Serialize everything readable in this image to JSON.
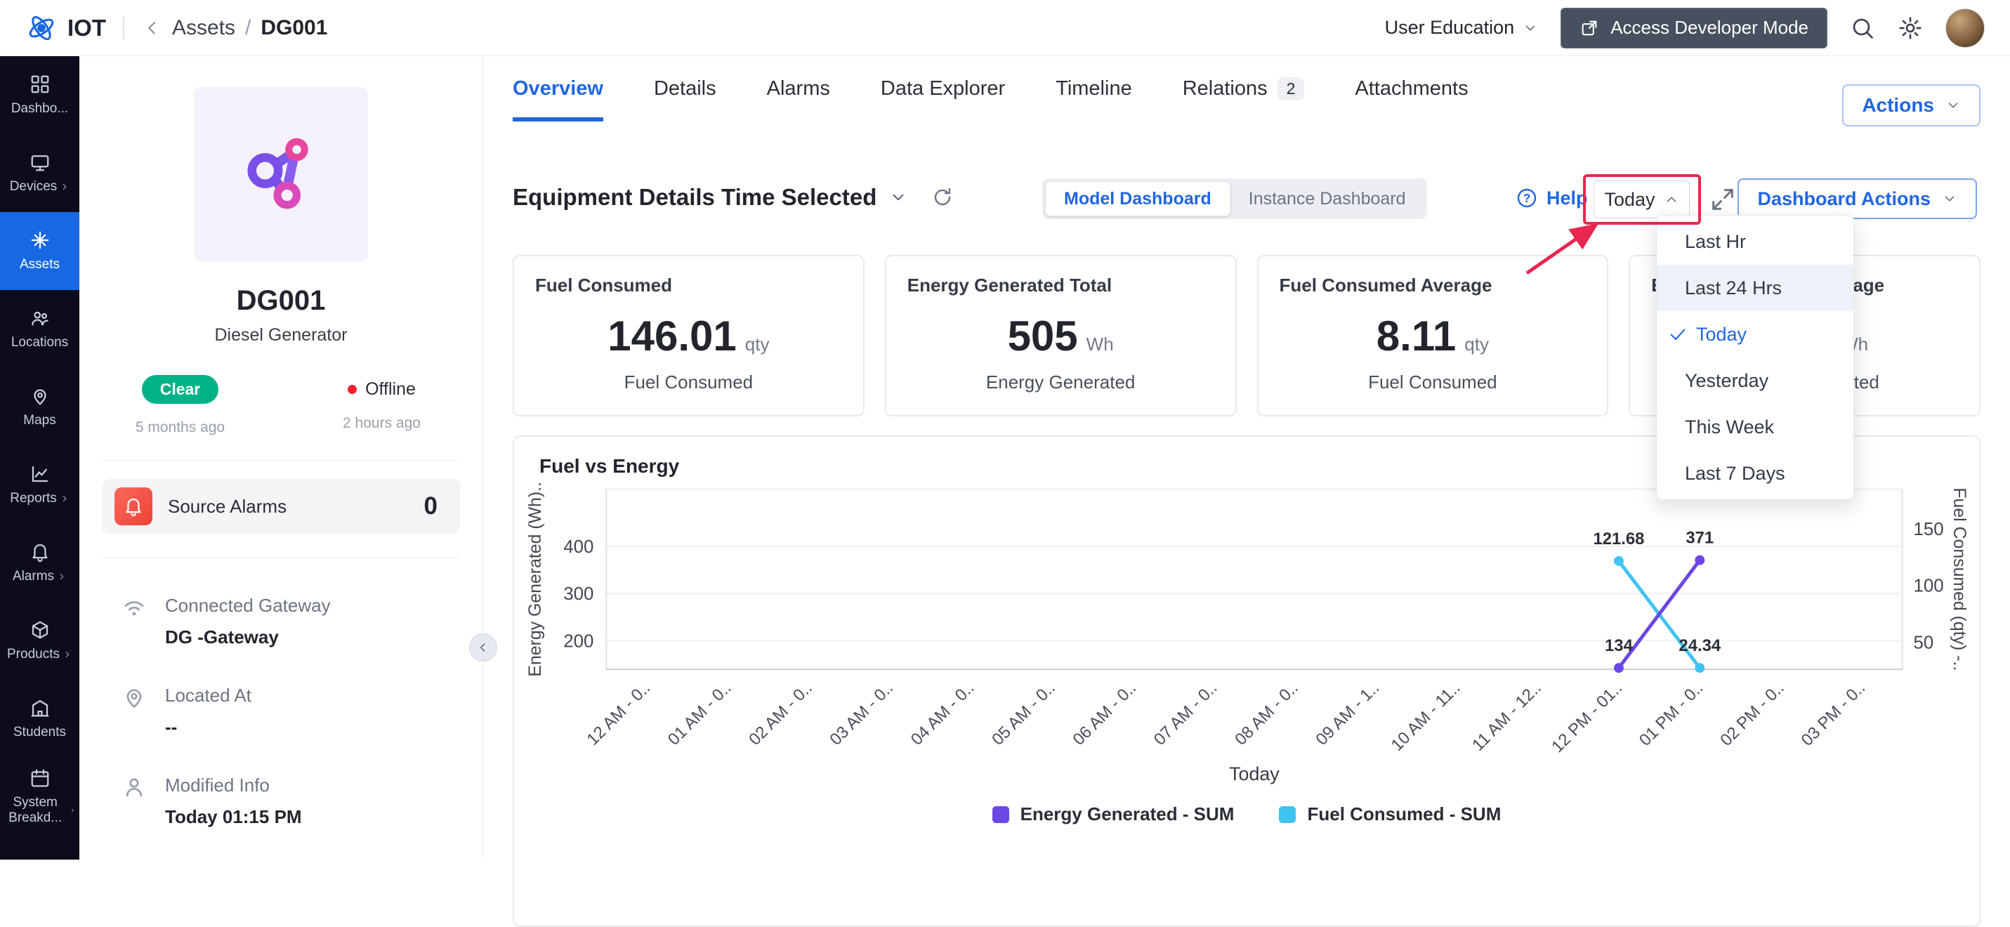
{
  "header": {
    "brand": "IOT",
    "breadcrumb": {
      "section": "Assets",
      "separator": "/",
      "current": "DG001"
    },
    "org_selector": "User Education",
    "developer_mode_label": "Access Developer Mode"
  },
  "sidebar": {
    "items": [
      {
        "label": "Dashbo...",
        "expandable": false,
        "active": false
      },
      {
        "label": "Devices",
        "expandable": true,
        "active": false
      },
      {
        "label": "Assets",
        "expandable": false,
        "active": true
      },
      {
        "label": "Locations",
        "expandable": false,
        "active": false
      },
      {
        "label": "Maps",
        "expandable": false,
        "active": false
      },
      {
        "label": "Reports",
        "expandable": true,
        "active": false
      },
      {
        "label": "Alarms",
        "expandable": true,
        "active": false
      },
      {
        "label": "Products",
        "expandable": true,
        "active": false
      },
      {
        "label": "Students",
        "expandable": false,
        "active": false
      },
      {
        "label": "System Breakd...",
        "expandable": true,
        "active": false
      }
    ]
  },
  "asset_panel": {
    "name": "DG001",
    "type": "Diesel Generator",
    "status_badge": "Clear",
    "status_time": "5 months ago",
    "connectivity": "Offline",
    "connectivity_time": "2 hours ago",
    "source_alarms": {
      "label": "Source Alarms",
      "count": "0"
    },
    "fields": [
      {
        "label": "Connected Gateway",
        "value": "DG -Gateway"
      },
      {
        "label": "Located At",
        "value": "--"
      },
      {
        "label": "Modified Info",
        "value": "Today 01:15 PM"
      }
    ]
  },
  "main": {
    "tabs": [
      {
        "label": "Overview",
        "active": true
      },
      {
        "label": "Details"
      },
      {
        "label": "Alarms"
      },
      {
        "label": "Data Explorer"
      },
      {
        "label": "Timeline"
      },
      {
        "label": "Relations",
        "badge": "2"
      },
      {
        "label": "Attachments"
      }
    ],
    "actions_button": "Actions",
    "dashboard_bar": {
      "title": "Equipment Details Time Selected",
      "segments": [
        {
          "label": "Model Dashboard",
          "active": true
        },
        {
          "label": "Instance Dashboard",
          "active": false
        }
      ],
      "help_label": "Help",
      "time_selector": "Today",
      "dashboard_actions_label": "Dashboard Actions"
    },
    "time_menu": [
      {
        "label": "Last Hr"
      },
      {
        "label": "Last 24 Hrs",
        "highlighted": true
      },
      {
        "label": "Today",
        "selected": true
      },
      {
        "label": "Yesterday"
      },
      {
        "label": "This Week"
      },
      {
        "label": "Last 7 Days"
      }
    ],
    "kpi_cards": [
      {
        "title": "Fuel Consumed",
        "value": "146.01",
        "unit": "qty",
        "label": "Fuel Consumed"
      },
      {
        "title": "Energy Generated Total",
        "value": "505",
        "unit": "Wh",
        "label": "Energy Generated"
      },
      {
        "title": "Fuel Consumed Average",
        "value": "8.11",
        "unit": "qty",
        "label": "Fuel Consumed"
      },
      {
        "title": "Energy Generated Average",
        "value": "",
        "unit": "Wh",
        "label": "Energy Generated"
      }
    ]
  },
  "chart_data": {
    "type": "line",
    "title": "Fuel vs Energy",
    "x_axis_title": "Today",
    "categories": [
      "12 AM - 0..",
      "01 AM - 0..",
      "02 AM - 0..",
      "03 AM - 0..",
      "04 AM - 0..",
      "05 AM - 0..",
      "06 AM - 0..",
      "07 AM - 0..",
      "08 AM - 0..",
      "09 AM - 1..",
      "10 AM - 11..",
      "11 AM - 12..",
      "12 PM - 01..",
      "01 PM - 0..",
      "02 PM - 0..",
      "03 PM - 0.."
    ],
    "left_axis": {
      "title": "Energy Generated (Wh)..",
      "ticks": [
        200,
        300,
        400
      ]
    },
    "right_axis": {
      "title": "Fuel Consumed (qty) -..",
      "ticks": [
        50,
        100,
        150
      ]
    },
    "series": [
      {
        "name": "Energy Generated - SUM",
        "color": "#6b46e5",
        "axis": "left",
        "points": [
          {
            "category": "12 PM - 01..",
            "value": 134,
            "label": "134"
          },
          {
            "category": "01 PM - 0..",
            "value": 371,
            "label": "371"
          }
        ]
      },
      {
        "name": "Fuel Consumed - SUM",
        "color": "#41c3f0",
        "axis": "right",
        "points": [
          {
            "category": "12 PM - 01..",
            "value": 121.68,
            "label": "121.68"
          },
          {
            "category": "01 PM - 0..",
            "value": 24.34,
            "label": "24.34"
          }
        ]
      }
    ],
    "legend_position": "bottom",
    "grid": true
  },
  "annotation": {
    "type": "highlight",
    "color": "#e8264e"
  }
}
